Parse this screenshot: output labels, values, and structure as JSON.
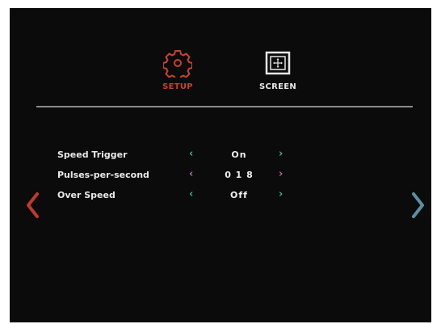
{
  "tabs": {
    "setup": {
      "label": "SETUP",
      "icon": "gear-icon",
      "color": "#c8412f",
      "active": true
    },
    "screen": {
      "label": "SCREEN",
      "icon": "screen-move-icon",
      "color": "#e6e6e6",
      "active": false
    }
  },
  "settings": [
    {
      "label": "Speed Trigger",
      "value": "On",
      "focused": false
    },
    {
      "label": "Pulses-per-second",
      "value": "0 1 8",
      "focused": true
    },
    {
      "label": "Over Speed",
      "value": "Off",
      "focused": false
    }
  ],
  "arrows": {
    "left": "‹",
    "right": "›"
  },
  "nav": {
    "prev_icon": "chevron-left-icon",
    "next_icon": "chevron-right-icon",
    "prev_color": "#c0392b",
    "next_color": "#5a8fa0"
  }
}
